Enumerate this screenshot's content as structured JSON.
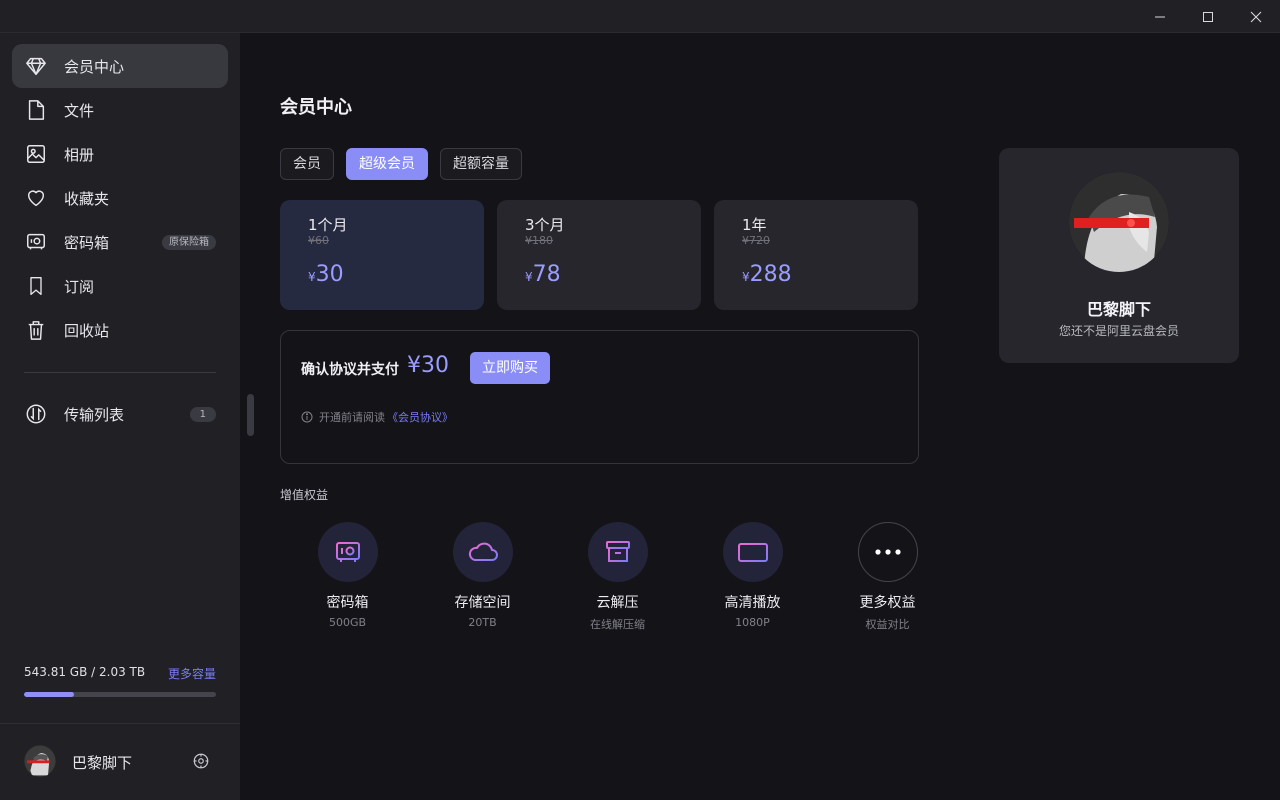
{
  "sidebar": {
    "nav": [
      {
        "label": "会员中心",
        "icon": "diamond-icon",
        "active": true
      },
      {
        "label": "文件",
        "icon": "file-icon"
      },
      {
        "label": "相册",
        "icon": "album-icon"
      },
      {
        "label": "收藏夹",
        "icon": "heart-icon"
      },
      {
        "label": "密码箱",
        "icon": "safe-icon",
        "badge": "原保险箱"
      },
      {
        "label": "订阅",
        "icon": "bookmark-icon"
      },
      {
        "label": "回收站",
        "icon": "trash-icon"
      }
    ],
    "transfer": {
      "label": "传输列表",
      "icon": "transfer-icon",
      "badge": "1"
    },
    "storage": {
      "used_text": "543.81 GB / 2.03 TB",
      "more_label": "更多容量",
      "used_fraction": 0.26
    },
    "user": {
      "name": "巴黎脚下"
    }
  },
  "main": {
    "title": "会员中心",
    "tabs": [
      {
        "label": "会员"
      },
      {
        "label": "超级会员",
        "active": true
      },
      {
        "label": "超额容量"
      }
    ],
    "plans": [
      {
        "name": "1个月",
        "original": "¥60",
        "currency": "¥",
        "price": "30",
        "active": true
      },
      {
        "name": "3个月",
        "original": "¥180",
        "currency": "¥",
        "price": "78"
      },
      {
        "name": "1年",
        "original": "¥720",
        "currency": "¥",
        "price": "288"
      }
    ],
    "payment": {
      "label": "确认协议并支付",
      "amount": "¥30",
      "buy_label": "立即购买",
      "notice_text": "开通前请阅读",
      "agreement_link": "《会员协议》"
    },
    "perks_title": "增值权益",
    "perks": [
      {
        "title": "密码箱",
        "sub": "500GB",
        "icon": "safe-icon"
      },
      {
        "title": "存储空间",
        "sub": "20TB",
        "icon": "cloud-icon"
      },
      {
        "title": "云解压",
        "sub": "在线解压缩",
        "icon": "archive-icon"
      },
      {
        "title": "高清播放",
        "sub": "1080P",
        "icon": "card-icon"
      },
      {
        "title": "更多权益",
        "sub": "权益对比",
        "icon": "more-dots-icon"
      }
    ]
  },
  "profile": {
    "name": "巴黎脚下",
    "status": "您还不是阿里云盘会员"
  },
  "colors": {
    "accent": "#8b8df7",
    "price": "#9a9cff",
    "background": "#141418",
    "sidebar": "#202025"
  }
}
